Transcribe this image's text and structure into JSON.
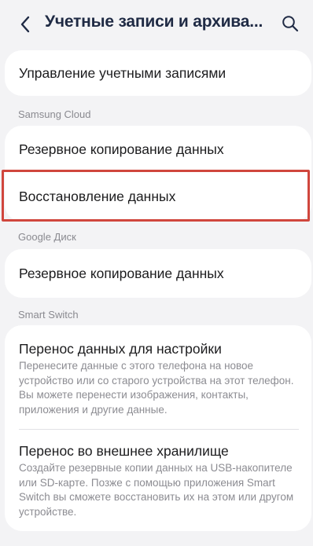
{
  "header": {
    "title": "Учетные записи и архива...",
    "back_icon": "chevron-left-icon",
    "search_icon": "search-icon"
  },
  "account_management": {
    "label": "Управление учетными записями"
  },
  "samsung_cloud": {
    "section_label": "Samsung Cloud",
    "backup_label": "Резервное копирование данных",
    "restore_label": "Восстановление данных"
  },
  "google_drive": {
    "section_label": "Google Диск",
    "backup_label": "Резервное копирование данных"
  },
  "smart_switch": {
    "section_label": "Smart Switch",
    "transfer": {
      "title": "Перенос данных для настройки",
      "description": "Перенесите данные с этого телефона на новое устройство или со старого устройства на этот телефон. Вы можете перенести изображения, контакты, приложения и другие данные."
    },
    "external": {
      "title": "Перенос во внешнее хранилище",
      "description": "Создайте резервные копии данных на USB-накопителе или SD-карте. Позже с помощью приложения Smart Switch вы сможете восстановить их на этом или другом устройстве."
    }
  },
  "colors": {
    "background": "#f3f3f5",
    "card": "#ffffff",
    "highlight_border": "#d0463d",
    "title": "#1f2a44"
  }
}
